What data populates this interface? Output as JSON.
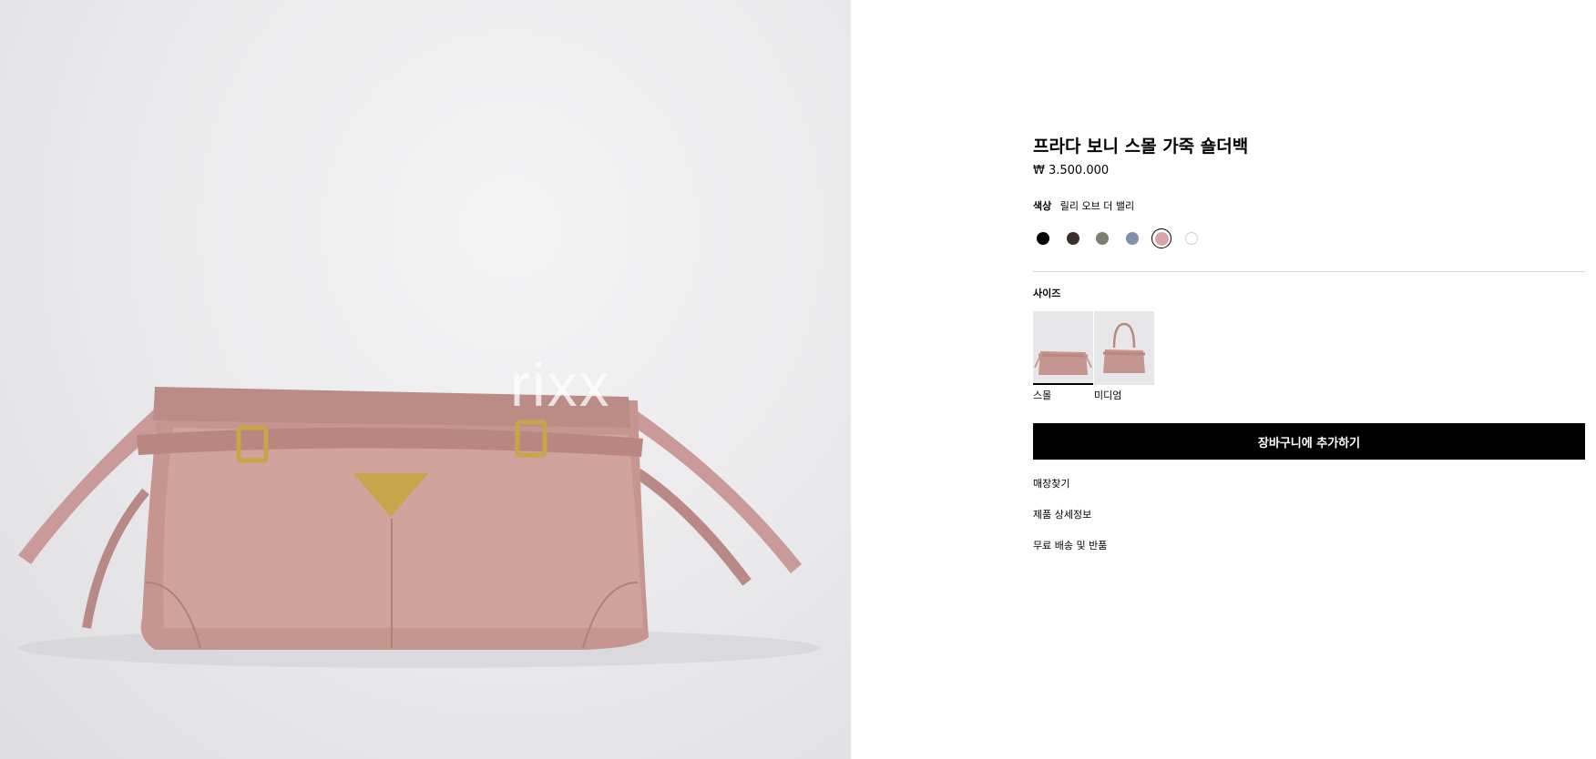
{
  "hero": {
    "watermark": "rixx"
  },
  "product": {
    "title": "프라다 보니 스몰 가죽 숄더백",
    "price": "₩ 3.500.000"
  },
  "color": {
    "label": "색상",
    "selected_name": "릴리 오브 더 밸리",
    "swatches": [
      {
        "color": "#000000"
      },
      {
        "color": "#3b2e2b"
      },
      {
        "color": "#7c7f74"
      },
      {
        "color": "#8190ab"
      },
      {
        "color": "#d9a3ab",
        "selected": true
      },
      {
        "color": "#ffffff"
      }
    ]
  },
  "size": {
    "label": "사이즈",
    "options": [
      {
        "label": "스몰",
        "selected": true
      },
      {
        "label": "미디엄"
      }
    ]
  },
  "cart_button": "장바구니에 추가하기",
  "links": [
    "매장찾기",
    "제품 상세정보",
    "무료 배송 및 반품"
  ]
}
